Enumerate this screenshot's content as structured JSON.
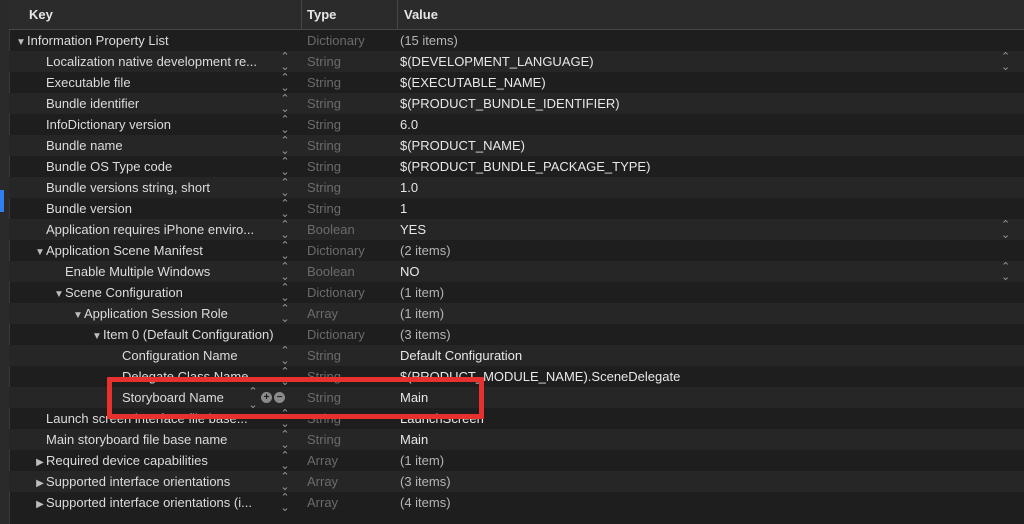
{
  "header": {
    "key": "Key",
    "type": "Type",
    "value": "Value"
  },
  "rows": [
    {
      "indent": 0,
      "tri": "down",
      "key": "Information Property List",
      "type": "Dictionary",
      "value": "(15 items)",
      "dim": true,
      "step": false,
      "rstep": false
    },
    {
      "indent": 1,
      "tri": "none",
      "key": "Localization native development re...",
      "type": "String",
      "value": "$(DEVELOPMENT_LANGUAGE)",
      "step": true,
      "rstep": true
    },
    {
      "indent": 1,
      "tri": "none",
      "key": "Executable file",
      "type": "String",
      "value": "$(EXECUTABLE_NAME)",
      "step": true
    },
    {
      "indent": 1,
      "tri": "none",
      "key": "Bundle identifier",
      "type": "String",
      "value": "$(PRODUCT_BUNDLE_IDENTIFIER)",
      "step": true
    },
    {
      "indent": 1,
      "tri": "none",
      "key": "InfoDictionary version",
      "type": "String",
      "value": "6.0",
      "step": true
    },
    {
      "indent": 1,
      "tri": "none",
      "key": "Bundle name",
      "type": "String",
      "value": "$(PRODUCT_NAME)",
      "step": true
    },
    {
      "indent": 1,
      "tri": "none",
      "key": "Bundle OS Type code",
      "type": "String",
      "value": "$(PRODUCT_BUNDLE_PACKAGE_TYPE)",
      "step": true
    },
    {
      "indent": 1,
      "tri": "none",
      "key": "Bundle versions string, short",
      "type": "String",
      "value": "1.0",
      "step": true
    },
    {
      "indent": 1,
      "tri": "none",
      "key": "Bundle version",
      "type": "String",
      "value": "1",
      "step": true
    },
    {
      "indent": 1,
      "tri": "none",
      "key": "Application requires iPhone enviro...",
      "type": "Boolean",
      "value": "YES",
      "step": true,
      "rstep": true
    },
    {
      "indent": 1,
      "tri": "down",
      "key": "Application Scene Manifest",
      "type": "Dictionary",
      "value": "(2 items)",
      "dim": true,
      "step": true
    },
    {
      "indent": 2,
      "tri": "none",
      "key": "Enable Multiple Windows",
      "type": "Boolean",
      "value": "NO",
      "step": true,
      "rstep": true
    },
    {
      "indent": 2,
      "tri": "down",
      "key": "Scene Configuration",
      "type": "Dictionary",
      "value": "(1 item)",
      "dim": true,
      "step": true
    },
    {
      "indent": 3,
      "tri": "down",
      "key": "Application Session Role",
      "type": "Array",
      "value": "(1 item)",
      "dim": true,
      "step": true
    },
    {
      "indent": 4,
      "tri": "down",
      "key": "Item 0 (Default Configuration)",
      "type": "Dictionary",
      "value": "(3 items)",
      "dim": true,
      "step": false
    },
    {
      "indent": 5,
      "tri": "none",
      "key": "Configuration Name",
      "type": "String",
      "value": "Default Configuration",
      "step": true
    },
    {
      "indent": 5,
      "tri": "none",
      "key": "Delegate Class Name",
      "type": "String",
      "value": "$(PRODUCT_MODULE_NAME).SceneDelegate",
      "step": true
    },
    {
      "indent": 5,
      "tri": "none",
      "key": "Storyboard Name",
      "type": "String",
      "value": "Main",
      "ctrls": true
    },
    {
      "indent": 1,
      "tri": "none",
      "key": "Launch screen interface file base...",
      "type": "String",
      "value": "LaunchScreen",
      "step": true
    },
    {
      "indent": 1,
      "tri": "none",
      "key": "Main storyboard file base name",
      "type": "String",
      "value": "Main",
      "step": true
    },
    {
      "indent": 1,
      "tri": "right",
      "key": "Required device capabilities",
      "type": "Array",
      "value": "(1 item)",
      "dim": true,
      "step": true
    },
    {
      "indent": 1,
      "tri": "right",
      "key": "Supported interface orientations",
      "type": "Array",
      "value": "(3 items)",
      "dim": true,
      "step": true
    },
    {
      "indent": 1,
      "tri": "right",
      "key": "Supported interface orientations (i...",
      "type": "Array",
      "value": "(4 items)",
      "dim": true,
      "step": true
    }
  ],
  "icons": {
    "down": "▼",
    "right": "▶",
    "stepper": "⌃⌄",
    "add": "+",
    "remove": "−"
  },
  "colors": {
    "highlight": "#e8312e",
    "background": "#1e1e1e"
  }
}
